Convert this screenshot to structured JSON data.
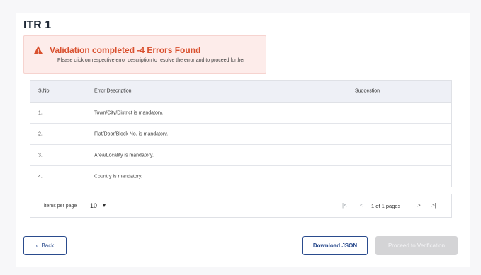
{
  "page": {
    "title": "ITR 1"
  },
  "alert": {
    "title": "Validation completed -4 Errors Found",
    "subtitle": "Please click on respective error description to resolve the error and to proceed further",
    "color": "#d9502e",
    "icon": "warning-icon"
  },
  "table": {
    "headers": {
      "sno": "S.No.",
      "description": "Error Description",
      "suggestion": "Suggestion"
    },
    "rows": [
      {
        "sno": "1.",
        "description": "Town/City/District is mandatory.",
        "suggestion": ""
      },
      {
        "sno": "2.",
        "description": "Flat/Door/Block No. is mandatory.",
        "suggestion": ""
      },
      {
        "sno": "3.",
        "description": "Area/Locality is mandatory.",
        "suggestion": ""
      },
      {
        "sno": "4.",
        "description": "Country is mandatory.",
        "suggestion": ""
      }
    ]
  },
  "pagination": {
    "items_per_page_label": "items per page",
    "items_per_page_value": "10",
    "first": "|<",
    "prev": "<",
    "pages_info": "1 of 1 pages",
    "next": ">",
    "last": ">|"
  },
  "buttons": {
    "back": "Back",
    "back_icon": "‹",
    "download_json": "Download JSON",
    "proceed": "Proceed to Verification"
  },
  "colors": {
    "primary": "#2a4b8d",
    "disabled": "#d4d4d6"
  }
}
